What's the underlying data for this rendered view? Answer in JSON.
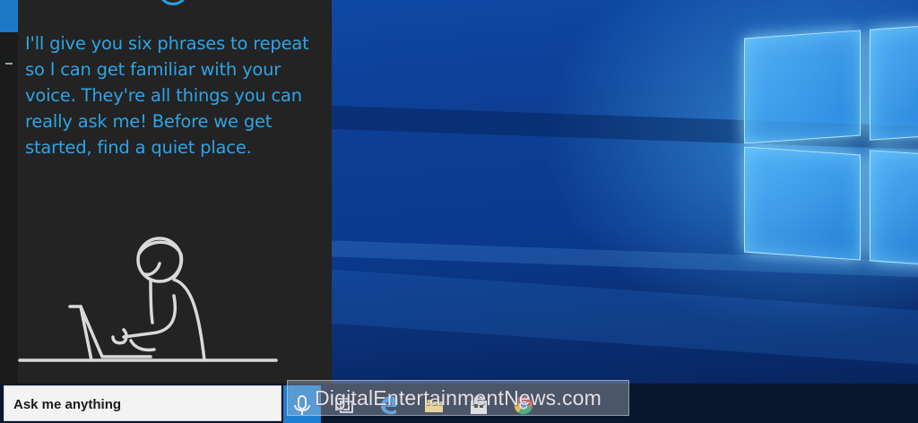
{
  "cortana": {
    "message": "I'll give you six phrases to repeat so I can get familiar with your voice. They're all things you can really ask me! Before we get started, find a quiet place."
  },
  "taskbar": {
    "search_placeholder": "Ask me anything",
    "icons": [
      "microphone-icon",
      "task-view-icon",
      "edge-icon",
      "file-explorer-icon",
      "store-icon",
      "chrome-icon"
    ]
  },
  "watermark": {
    "text": "DigitalEntertainmentNews.com"
  },
  "colors": {
    "cortana_text": "#2ea4e6",
    "cortana_bg": "#232323",
    "accent": "#1d7fd1",
    "taskbar_bg": "#08172e"
  }
}
